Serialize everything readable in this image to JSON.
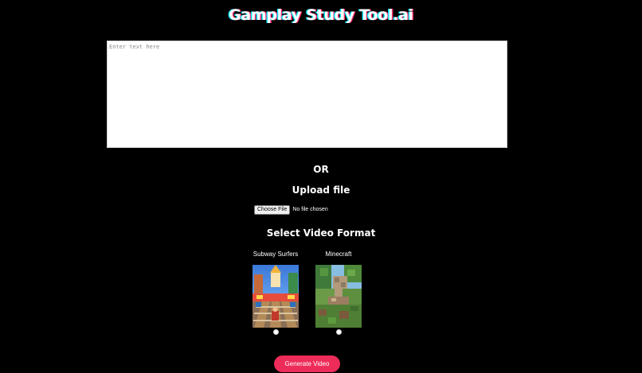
{
  "header": {
    "title": "Gamplay Study Tool.ai"
  },
  "text_input": {
    "placeholder": "Enter text here",
    "value": ""
  },
  "divider": {
    "or_label": "OR"
  },
  "upload": {
    "heading": "Upload file",
    "choose_button_label": "Choose File",
    "status_text": "No file chosen"
  },
  "video_format": {
    "heading": "Select Video Format",
    "options": [
      {
        "label": "Subway Surfers",
        "selected": false,
        "thumbnail_icon": "subway-surfers-thumbnail"
      },
      {
        "label": "Minecraft",
        "selected": false,
        "thumbnail_icon": "minecraft-thumbnail"
      }
    ]
  },
  "actions": {
    "generate_label": "Generate Video"
  },
  "colors": {
    "background": "#000000",
    "accent": "#ee2c59",
    "title_shadow_left": "#00e5ff",
    "title_shadow_right": "#ff2d6b"
  }
}
